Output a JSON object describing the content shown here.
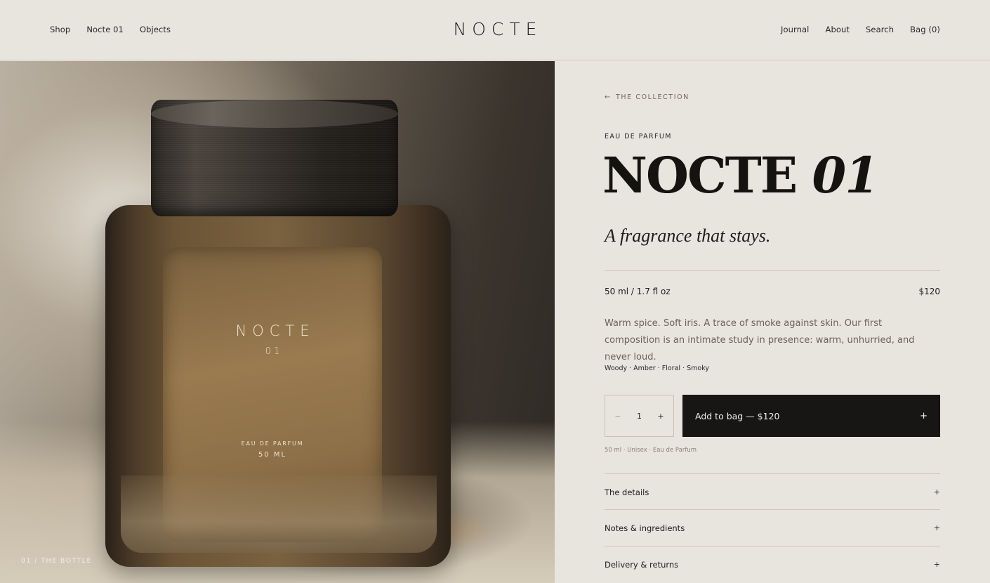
{
  "header": {
    "nav_left": [
      "Shop",
      "Nocte 01",
      "Objects"
    ],
    "logo": "NOCTE",
    "nav_right": [
      "Journal",
      "About",
      "Search",
      "Bag (0)"
    ]
  },
  "hero": {
    "bottle_name": "NOCTE",
    "bottle_number": "01",
    "bottle_type": "EAU DE PARFUM",
    "bottle_volume": "50 ML",
    "caption": "01 / THE BOTTLE"
  },
  "product": {
    "back_arrow": "←",
    "back_label": "THE COLLECTION",
    "eyebrow": "EAU DE PARFUM",
    "title_main": "NOCTE",
    "title_number": "01",
    "tagline": "A fragrance that stays.",
    "size": "50 ml / 1.7 fl oz",
    "price": "$120",
    "description": "Warm spice. Soft iris. A trace of smoke against skin. Our first composition is an intimate study in presence: warm, unhurried, and never loud.",
    "notes": "Woody · Amber · Floral · Smoky",
    "quantity": {
      "minus": "−",
      "value": "1",
      "plus": "+"
    },
    "add_to_bag": {
      "label": "Add to bag — $120",
      "icon": "+"
    },
    "meta": "50 ml · Unisex · Eau de Parfum",
    "accordion": [
      {
        "label": "The details",
        "icon": "+"
      },
      {
        "label": "Notes & ingredients",
        "icon": "+"
      },
      {
        "label": "Delivery & returns",
        "icon": "+"
      }
    ]
  }
}
